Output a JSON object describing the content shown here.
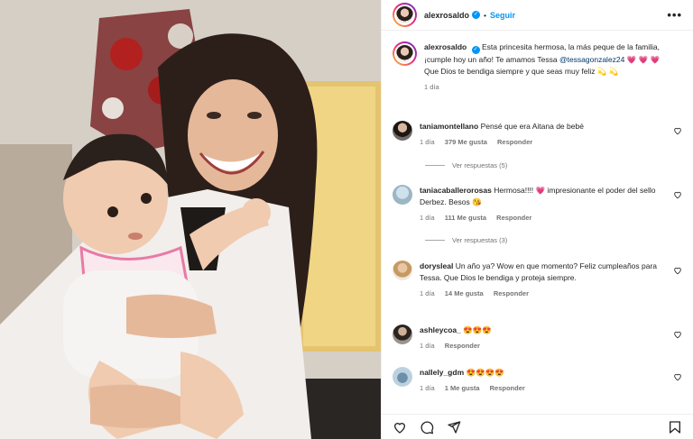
{
  "header": {
    "username": "alexrosaldo",
    "verified": "✓",
    "separator": "•",
    "follow_label": "Seguir",
    "more_label": "•••"
  },
  "caption": {
    "username": "alexrosaldo",
    "verified": "✓",
    "text_1": "Esta princesita hermosa, la más peque de la familia, ¡cumple hoy un año! Te amamos Tessa",
    "mention": "@tessagonzalez24",
    "emojis": "💗 💗 💗",
    "text_2": "Que Dios te bendiga siempre y que seas muy feliz",
    "emojis_end": "💫 💫",
    "time": "1 día"
  },
  "comments": [
    {
      "user": "taniamontellano",
      "text": "Pensé que era Aitana de bebé",
      "time": "1 día",
      "likes": "379 Me gusta",
      "reply": "Responder",
      "view_replies": "Ver respuestas (5)"
    },
    {
      "user": "taniacaballerorosas",
      "text": "Hermosa!!!! 💗 impresionante el poder del sello Derbez. Besos 😘",
      "time": "1 día",
      "likes": "111 Me gusta",
      "reply": "Responder",
      "view_replies": "Ver respuestas (3)"
    },
    {
      "user": "dorysleal",
      "text": "Un año ya? Wow en que momento? Feliz cumpleaños para Tessa. Que Dios le bendiga y proteja siempre.",
      "time": "1 día",
      "likes": "14 Me gusta",
      "reply": "Responder"
    },
    {
      "user": "ashleycoa_",
      "text": "😍😍😍",
      "time": "1 día",
      "reply": "Responder"
    },
    {
      "user": "nallely_gdm",
      "text": "😍😍😍😍",
      "time": "1 día",
      "likes": "1 Me gusta",
      "reply": "Responder"
    }
  ],
  "colors": {
    "accent": "#0095f6",
    "muted": "#737373",
    "text": "#262626",
    "heart_pink": "#e4405f"
  },
  "icons": [
    "heart-icon",
    "comment-icon",
    "share-icon",
    "bookmark-icon",
    "more-icon",
    "verified-icon"
  ]
}
